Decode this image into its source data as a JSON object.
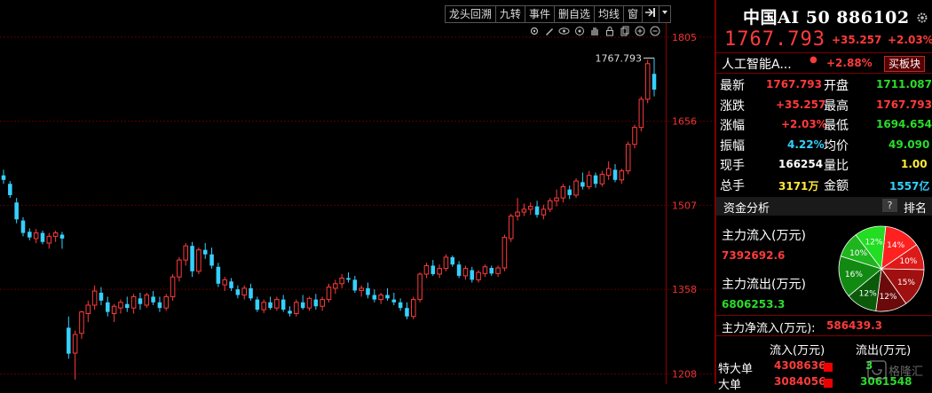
{
  "toolbar": {
    "tabs": [
      "龙头回溯",
      "九转",
      "事件",
      "删自选",
      "均线",
      "窗"
    ],
    "tools": [
      "settings-icon",
      "pen-icon",
      "eye-icon",
      "pointer-icon",
      "hand-icon",
      "lock-icon",
      "copy-icon",
      "zoom-in-icon",
      "zoom-out-icon"
    ]
  },
  "chart": {
    "high_marker": "1767.793",
    "axis_labels": [
      "1805",
      "1656",
      "1507",
      "1358",
      "1208"
    ],
    "colors": {
      "up": "#ff3b3b",
      "down": "#35d0ff",
      "grid": "#5a0000",
      "axis_text": "#ee3333"
    }
  },
  "chart_data": {
    "type": "candlestick",
    "ylim": [
      1190,
      1830
    ],
    "yticks": [
      1805,
      1656,
      1507,
      1358,
      1208
    ],
    "candles": [
      [
        1560,
        1570,
        1545,
        1552
      ],
      [
        1545,
        1550,
        1520,
        1525
      ],
      [
        1512,
        1520,
        1475,
        1482
      ],
      [
        1480,
        1486,
        1452,
        1458
      ],
      [
        1460,
        1466,
        1445,
        1450
      ],
      [
        1448,
        1465,
        1440,
        1458
      ],
      [
        1458,
        1462,
        1438,
        1442
      ],
      [
        1440,
        1458,
        1430,
        1452
      ],
      [
        1452,
        1462,
        1442,
        1458
      ],
      [
        1455,
        1460,
        1430,
        1448
      ],
      [
        1290,
        1310,
        1235,
        1244
      ],
      [
        1245,
        1285,
        1198,
        1278
      ],
      [
        1280,
        1320,
        1270,
        1318
      ],
      [
        1315,
        1338,
        1300,
        1330
      ],
      [
        1330,
        1365,
        1322,
        1355
      ],
      [
        1352,
        1362,
        1330,
        1338
      ],
      [
        1335,
        1345,
        1310,
        1318
      ],
      [
        1315,
        1332,
        1300,
        1328
      ],
      [
        1325,
        1340,
        1315,
        1335
      ],
      [
        1332,
        1345,
        1318,
        1325
      ],
      [
        1325,
        1350,
        1315,
        1345
      ],
      [
        1342,
        1352,
        1322,
        1332
      ],
      [
        1330,
        1352,
        1325,
        1348
      ],
      [
        1345,
        1355,
        1330,
        1335
      ],
      [
        1335,
        1345,
        1318,
        1325
      ],
      [
        1325,
        1350,
        1320,
        1345
      ],
      [
        1345,
        1385,
        1338,
        1380
      ],
      [
        1380,
        1415,
        1372,
        1410
      ],
      [
        1410,
        1440,
        1400,
        1435
      ],
      [
        1435,
        1442,
        1380,
        1390
      ],
      [
        1390,
        1432,
        1385,
        1428
      ],
      [
        1428,
        1440,
        1412,
        1420
      ],
      [
        1420,
        1432,
        1395,
        1400
      ],
      [
        1398,
        1405,
        1362,
        1368
      ],
      [
        1366,
        1380,
        1355,
        1375
      ],
      [
        1372,
        1378,
        1355,
        1360
      ],
      [
        1358,
        1365,
        1342,
        1348
      ],
      [
        1348,
        1365,
        1340,
        1360
      ],
      [
        1360,
        1368,
        1338,
        1342
      ],
      [
        1340,
        1345,
        1318,
        1322
      ],
      [
        1322,
        1340,
        1316,
        1335
      ],
      [
        1335,
        1345,
        1322,
        1325
      ],
      [
        1325,
        1345,
        1320,
        1340
      ],
      [
        1340,
        1348,
        1318,
        1322
      ],
      [
        1320,
        1328,
        1310,
        1315
      ],
      [
        1315,
        1340,
        1310,
        1335
      ],
      [
        1335,
        1348,
        1322,
        1325
      ],
      [
        1325,
        1345,
        1320,
        1342
      ],
      [
        1340,
        1350,
        1322,
        1328
      ],
      [
        1328,
        1345,
        1320,
        1340
      ],
      [
        1340,
        1368,
        1335,
        1362
      ],
      [
        1360,
        1375,
        1350,
        1368
      ],
      [
        1368,
        1385,
        1360,
        1378
      ],
      [
        1378,
        1388,
        1370,
        1375
      ],
      [
        1375,
        1382,
        1352,
        1356
      ],
      [
        1356,
        1365,
        1345,
        1360
      ],
      [
        1360,
        1370,
        1342,
        1348
      ],
      [
        1348,
        1358,
        1335,
        1340
      ],
      [
        1340,
        1352,
        1332,
        1348
      ],
      [
        1348,
        1360,
        1338,
        1342
      ],
      [
        1340,
        1352,
        1330,
        1335
      ],
      [
        1335,
        1342,
        1320,
        1325
      ],
      [
        1325,
        1335,
        1305,
        1310
      ],
      [
        1310,
        1345,
        1305,
        1340
      ],
      [
        1340,
        1388,
        1335,
        1385
      ],
      [
        1385,
        1405,
        1378,
        1400
      ],
      [
        1400,
        1410,
        1382,
        1385
      ],
      [
        1385,
        1402,
        1378,
        1395
      ],
      [
        1395,
        1420,
        1390,
        1415
      ],
      [
        1415,
        1418,
        1398,
        1402
      ],
      [
        1402,
        1408,
        1378,
        1382
      ],
      [
        1382,
        1400,
        1375,
        1395
      ],
      [
        1392,
        1398,
        1370,
        1375
      ],
      [
        1375,
        1392,
        1370,
        1388
      ],
      [
        1386,
        1402,
        1380,
        1398
      ],
      [
        1396,
        1400,
        1382,
        1386
      ],
      [
        1386,
        1400,
        1380,
        1396
      ],
      [
        1396,
        1455,
        1390,
        1450
      ],
      [
        1448,
        1492,
        1442,
        1488
      ],
      [
        1488,
        1520,
        1480,
        1495
      ],
      [
        1495,
        1510,
        1488,
        1500
      ],
      [
        1500,
        1512,
        1490,
        1505
      ],
      [
        1505,
        1515,
        1485,
        1490
      ],
      [
        1490,
        1508,
        1482,
        1500
      ],
      [
        1500,
        1520,
        1495,
        1515
      ],
      [
        1515,
        1535,
        1505,
        1520
      ],
      [
        1520,
        1545,
        1512,
        1540
      ],
      [
        1535,
        1542,
        1518,
        1525
      ],
      [
        1525,
        1555,
        1520,
        1550
      ],
      [
        1548,
        1565,
        1535,
        1540
      ],
      [
        1540,
        1568,
        1535,
        1560
      ],
      [
        1560,
        1565,
        1538,
        1545
      ],
      [
        1545,
        1568,
        1540,
        1562
      ],
      [
        1560,
        1585,
        1552,
        1572
      ],
      [
        1570,
        1580,
        1548,
        1552
      ],
      [
        1552,
        1572,
        1545,
        1568
      ],
      [
        1568,
        1620,
        1562,
        1615
      ],
      [
        1615,
        1650,
        1608,
        1645
      ],
      [
        1645,
        1700,
        1638,
        1695
      ],
      [
        1695,
        1765,
        1688,
        1758
      ],
      [
        1740,
        1768,
        1700,
        1712
      ]
    ],
    "high_label": "1767.793"
  },
  "quote": {
    "title": "中国AI 50 886102",
    "price": "1767.793",
    "change": "+35.257",
    "pct": "+2.03%",
    "sector_name": "人工智能A...",
    "sector_dot": "●",
    "sector_pct": "+2.88%",
    "sector_btn": "买板块",
    "stats": [
      {
        "l1": "最新",
        "v1": "1767.793",
        "c1": "red",
        "l2": "开盘",
        "v2": "1711.087",
        "c2": "green"
      },
      {
        "l1": "涨跌",
        "v1": "+35.257",
        "c1": "red",
        "l2": "最高",
        "v2": "1767.793",
        "c2": "red"
      },
      {
        "l1": "涨幅",
        "v1": "+2.03%",
        "c1": "red",
        "l2": "最低",
        "v2": "1694.654",
        "c2": "green"
      },
      {
        "l1": "振幅",
        "v1": "4.22%",
        "c1": "cyan",
        "l2": "均价",
        "v2": "49.090",
        "c2": "green"
      },
      {
        "l1": "现手",
        "v1": "166254",
        "c1": "white",
        "l2": "量比",
        "v2": "1.00",
        "c2": "yellow"
      },
      {
        "l1": "总手",
        "v1": "3171万",
        "c1": "yellow",
        "l2": "金额",
        "v2": "1557亿",
        "c2": "cyan"
      }
    ],
    "fund": {
      "title": "资金分析",
      "q": "?",
      "rank": "排名",
      "inflow_label": "主力流入(万元)",
      "inflow_value": "7392692.6",
      "outflow_label": "主力流出(万元)",
      "outflow_value": "6806253.3",
      "net_label": "主力净流入(万元):",
      "net_value": "586439.3",
      "pie": [
        {
          "pct": "14%",
          "value": 14,
          "color": "#ff2020"
        },
        {
          "pct": "10%",
          "value": 10,
          "color": "#dd1a1a"
        },
        {
          "pct": "15%",
          "value": 15,
          "color": "#a01010"
        },
        {
          "pct": "12%",
          "value": 12,
          "color": "#6a0a0a"
        },
        {
          "pct": "12%",
          "value": 12,
          "color": "#0a5a0a"
        },
        {
          "pct": "16%",
          "value": 16,
          "color": "#128a12"
        },
        {
          "pct": "10%",
          "value": 10,
          "color": "#1fb51f"
        },
        {
          "pct": "12%",
          "value": 12,
          "color": "#22dd22"
        }
      ]
    },
    "table": {
      "col_in": "流入(万元)",
      "col_out": "流出(万元)",
      "rows": [
        {
          "name": "特大单",
          "in": "4308636",
          "out": "3"
        },
        {
          "name": "大单",
          "in": "3084056",
          "out": "3061548"
        }
      ]
    }
  },
  "watermark": "格隆汇"
}
